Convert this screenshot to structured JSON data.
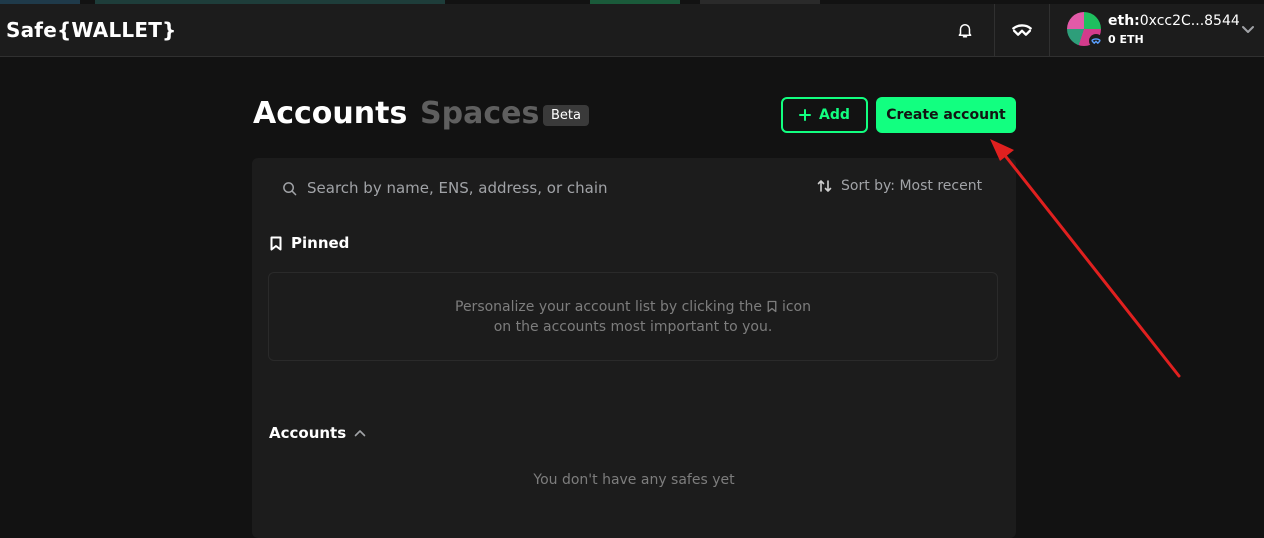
{
  "header": {
    "brand": "Safe{WALLET}",
    "account": {
      "address_prefix": "eth:",
      "address": "0xcc2C...8544",
      "balance": "0 ETH"
    }
  },
  "page": {
    "title_accounts": "Accounts",
    "title_spaces": "Spaces",
    "beta_badge": "Beta",
    "add_button": "Add",
    "create_button": "Create account"
  },
  "search": {
    "placeholder": "Search by name, ENS, address, or chain",
    "sort_label": "Sort by: Most recent"
  },
  "pinned": {
    "label": "Pinned",
    "empty_line1_a": "Personalize your account list by clicking the",
    "empty_line1_b": "icon",
    "empty_line2": "on the accounts most important to you."
  },
  "accounts_section": {
    "label": "Accounts",
    "empty": "You don't have any safes yet"
  },
  "colors": {
    "accent": "#12ff80",
    "background": "#121212",
    "panel": "#1c1c1c",
    "annotation_arrow": "#e0201f"
  },
  "icons": [
    "bell-icon",
    "walletconnect-icon",
    "chevron-down-icon",
    "plus-icon",
    "search-icon",
    "sort-icon",
    "bookmark-icon",
    "chevron-up-icon"
  ]
}
